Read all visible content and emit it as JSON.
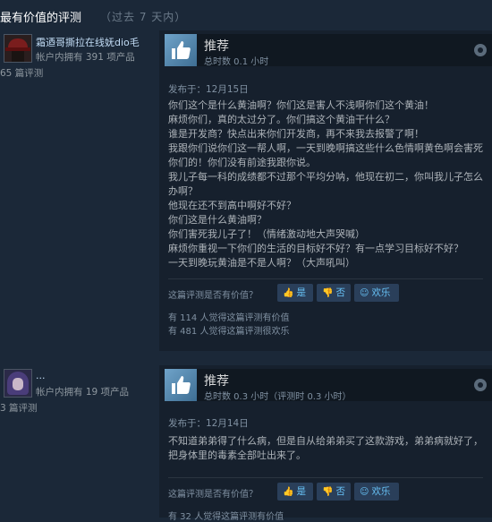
{
  "header": {
    "title": "最有价值的评测",
    "subtitle": "（过去 7 天内）"
  },
  "reviews": [
    {
      "user_name": "霜迺哥撕拉在线妩dio毛",
      "products": "帐户内拥有 391 项产品",
      "review_count": "65 篇评测",
      "recommendation": "推荐",
      "hours": "总时数 0.1 小时",
      "posted": "发布于：12月15日",
      "body": [
        "你们这个是什么黄油啊？你们这是害人不浅啊你们这个黄油！",
        "麻烦你们，真的太过分了。你们搞这个黄油干什么？",
        "谁是开发商？快点出来你们开发商，再不来我去报警了啊！",
        "我跟你们说你们这一帮人啊，一天到晚啊搞这些什么色情啊黄色啊会害死你们的！你们没有前途我跟你说。",
        "我儿子每一科的成绩都不过那个平均分呐，他现在初二，你叫我儿子怎么办啊？",
        "他现在还不到高中啊好不好？",
        "你们这是什么黄油啊？",
        "你们害死我儿子了！（情绪激动地大声哭喊）",
        "麻烦你重视一下你们的生活的目标好不好？有一点学习目标好不好？",
        "一天到晚玩黄油是不是人啊？（大声吼叫）"
      ],
      "helpful_question": "这篇评测是否有价值？",
      "yes_label": "是",
      "no_label": "否",
      "funny_label": "欢乐",
      "stat_helpful": "有 114 人觉得这篇评测有价值",
      "stat_funny": "有 481 人觉得这篇评测很欢乐"
    },
    {
      "user_name": "...",
      "products": "帐户内拥有 19 项产品",
      "review_count": "3 篇评测",
      "recommendation": "推荐",
      "hours": "总时数 0.3 小时（评测时 0.3 小时）",
      "posted": "发布于：12月14日",
      "body": [
        "不知道弟弟得了什么病，但是自从给弟弟买了这款游戏，弟弟病就好了，把身体里的毒素全部吐出来了。"
      ],
      "helpful_question": "这篇评测是否有价值？",
      "yes_label": "是",
      "no_label": "否",
      "funny_label": "欢乐",
      "stat_helpful": "有 32 人觉得这篇评测有价值"
    }
  ],
  "icons": {
    "thumbs_up": "thumbs-up-icon",
    "thumbs_down": "thumbs-down-icon",
    "funny": "smile-icon",
    "platform": "steam-icon"
  },
  "colors": {
    "background": "#1b2838",
    "panel": "#16202d",
    "link": "#67c1f5",
    "thumb_box": "#4f88b3"
  }
}
